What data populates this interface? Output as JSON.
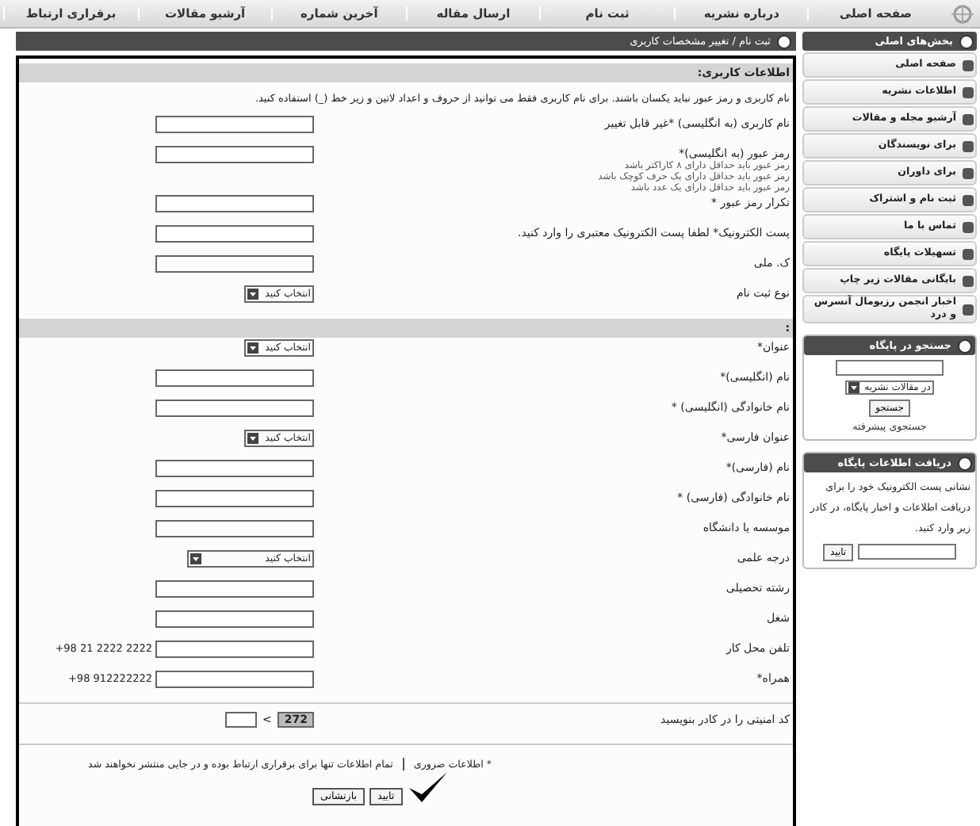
{
  "nav": [
    "صفحه اصلی",
    "درباره نشریه",
    "ثبت نام",
    "ارسال مقاله",
    "آخرین شماره",
    "آرشیو مقالات",
    "برقراری ارتباط"
  ],
  "breadcrumb": "ثبت نام / تغییر مشخصات کاربری",
  "sidebar": {
    "menu": {
      "title": "بخش‌های اصلی",
      "items": [
        "صفحه اصلی",
        "اطلاعات نشریه",
        "آرشیو مجله و مقالات",
        "برای نویسندگان",
        "برای داوران",
        "ثبت نام و اشتراک",
        "تماس با ما",
        "تسهیلات پایگاه",
        "بایگانی مقالات زیر چاپ",
        "اخبار انجمن رزیومال آنسرس و درد"
      ]
    },
    "search": {
      "title": "جستجو در پایگاه",
      "scope": "در مقالات نشریه",
      "button": "جستجو",
      "link": "جستجوی پیشرفته"
    },
    "newsletter": {
      "title": "دریافت اطلاعات پایگاه",
      "text": "نشانی پست الکترونیک خود را برای دریافت اطلاعات و اخبار پایگاه، در کادر زیر وارد کنید.",
      "button": "تایید"
    }
  },
  "form": {
    "sections": [
      {
        "title": "اطلاعات کاربری:",
        "note": "نام کاربری و رمز عبور نباید یکسان باشند. برای نام کاربری فقط می توانید از حروف و اعداد لاتین و زیر خط (_) استفاده کنید.",
        "fields": [
          {
            "kind": "text",
            "label": "نام کاربری (به انگلیسی) *غیر قابل تغییر"
          },
          {
            "kind": "password",
            "label": "رمز عبور (به انگلیسی)*",
            "hints": [
              "رمز عبور باید حداقل دارای ۸ کاراکتر باشد",
              "رمز عبور باید حداقل دارای یک حرف کوچک باشد",
              "رمز عبور باید حداقل دارای یک عدد باشد"
            ]
          },
          {
            "kind": "password",
            "label": "تکرار رمز عبور *"
          },
          {
            "kind": "text",
            "label": "پست الکترونیک* لطفا پست الکترونیک معتبری را وارد کنید."
          },
          {
            "kind": "text",
            "label": "ک. ملی"
          },
          {
            "kind": "select",
            "label": "نوع ثبت نام",
            "value": "انتخاب کنید"
          }
        ]
      },
      {
        "title": ":",
        "fields": [
          {
            "kind": "select",
            "label": "عنوان*",
            "value": "انتخاب کنید"
          },
          {
            "kind": "text",
            "label": "نام (انگلیسی)*"
          },
          {
            "kind": "text",
            "label": "نام خانوادگی (انگلیسی) *"
          },
          {
            "kind": "select",
            "label": "عنوان فارسی*",
            "value": "انتخاب کنید"
          },
          {
            "kind": "text",
            "label": "نام (فارسی)*"
          },
          {
            "kind": "text",
            "label": "نام خانوادگی (فارسی) *"
          },
          {
            "kind": "text",
            "label": "موسسه یا دانشگاه"
          },
          {
            "kind": "wideselect",
            "label": "درجه علمی",
            "value": "انتخاب کنید"
          },
          {
            "kind": "text",
            "label": "رشته تحصیلی"
          },
          {
            "kind": "text",
            "label": "شغل"
          },
          {
            "kind": "text",
            "label": "تلفن محل کار",
            "example": "+98 21 2222 2222"
          },
          {
            "kind": "text",
            "label": "همراه*",
            "example": "+98 912222222"
          }
        ]
      }
    ],
    "captcha": {
      "label": "کد امنیتی را در کادر بنویسید",
      "code": "272",
      "arrow": ">"
    },
    "required_note": "* اطلاعات ضروری",
    "privacy_note": "تمام اطلاعات تنها برای برقراری ارتباط بوده و در جایی منتشر نخواهند شد",
    "buttons": [
      "تایید",
      "بازنشانی"
    ]
  }
}
